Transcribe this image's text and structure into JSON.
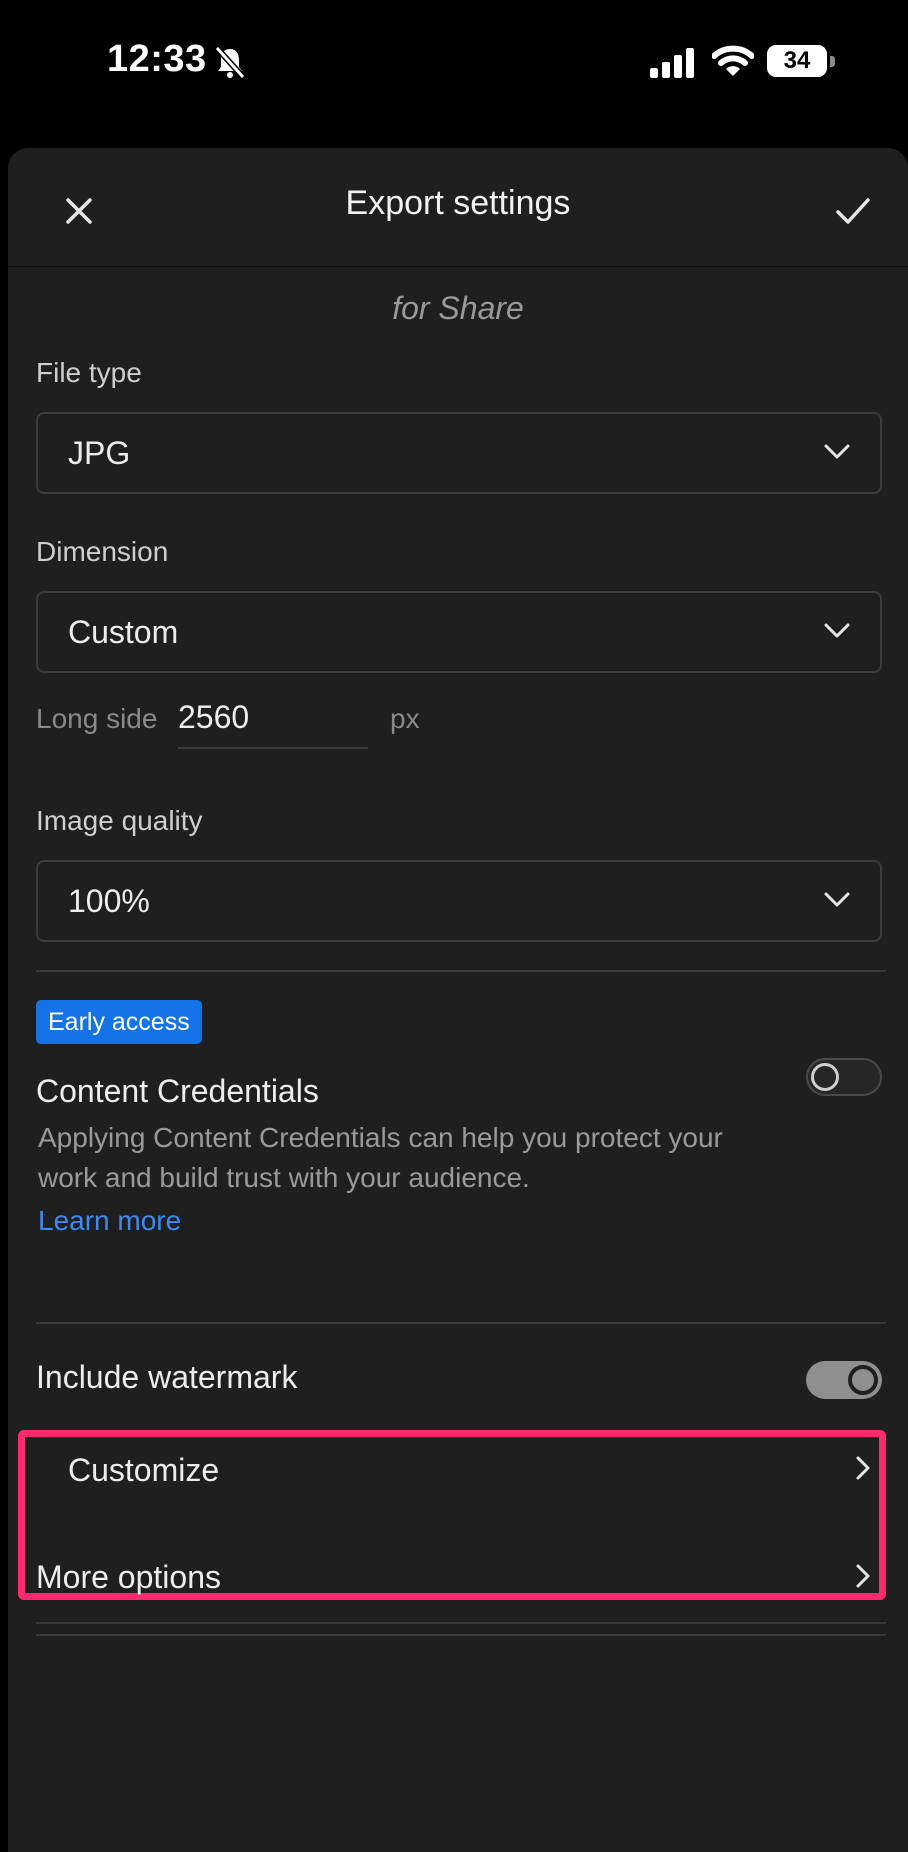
{
  "status_bar": {
    "time": "12:33",
    "battery": "34",
    "icons": [
      "bell-slash-icon",
      "cellular-signal-icon",
      "wifi-icon",
      "battery-icon"
    ]
  },
  "header": {
    "title": "Export settings",
    "close_icon": "close-icon",
    "confirm_icon": "checkmark-icon"
  },
  "subtitle": "for Share",
  "file_type": {
    "label": "File type",
    "value": "JPG"
  },
  "dimension": {
    "label": "Dimension",
    "value": "Custom"
  },
  "long_side": {
    "label": "Long side",
    "value": "2560",
    "unit": "px"
  },
  "image_quality": {
    "label": "Image quality",
    "value": "100%"
  },
  "content_credentials": {
    "badge": "Early access",
    "title": "Content Credentials",
    "enabled": false,
    "description": "Applying Content Credentials can help you protect your work and build trust with your audience.",
    "learn_more": "Learn more"
  },
  "watermark": {
    "title": "Include watermark",
    "enabled": true,
    "customize_label": "Customize"
  },
  "more_options": "More options",
  "colors": {
    "background": "#1f1f1f",
    "accent_blue": "#1473e6",
    "link_blue": "#3a8bf5",
    "highlight_pink": "#ff2a6d"
  }
}
